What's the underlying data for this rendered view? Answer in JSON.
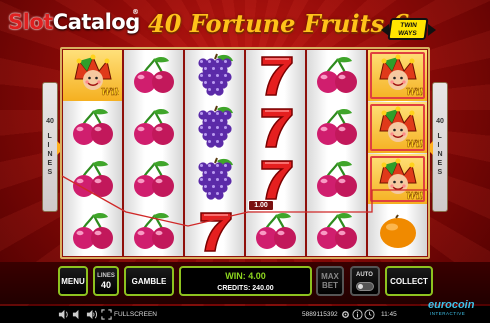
{
  "watermark": {
    "part1": "Slot",
    "part2": "Catalog",
    "mark": "®"
  },
  "title": {
    "number": "40",
    "text": "Fortune Fruits 6",
    "badge_line1": "TWIN",
    "badge_line2": "WAYS"
  },
  "side_panel": {
    "top": "40",
    "label": "LINES"
  },
  "symbol_labels": {
    "wild": "Wild"
  },
  "reels": [
    [
      "wild",
      "cherry",
      "cherry",
      "cherry"
    ],
    [
      "cherry",
      "cherry",
      "cherry",
      "cherry"
    ],
    [
      "grapes",
      "grapes",
      "grapes",
      "seven"
    ],
    [
      "seven",
      "seven",
      "seven",
      "cherry"
    ],
    [
      "cherry",
      "cherry",
      "cherry",
      "cherry"
    ],
    [
      "wild",
      "wild",
      "wild",
      "orange"
    ]
  ],
  "win_line_amount": "1.00",
  "controls": {
    "menu_label": "MENU",
    "lines_label": "LINES",
    "lines_value": "40",
    "gamble_label": "GAMBLE",
    "win_label": "WIN: 4.00",
    "credits_label": "CREDITS: 240.00",
    "max_bet_label_1": "MAX",
    "max_bet_label_2": "BET",
    "auto_label": "AUTO",
    "collect_label": "COLLECT"
  },
  "status_bar": {
    "fullscreen_label": "FULLSCREEN",
    "session_id": "5889115392",
    "time": "11:45"
  },
  "brand": {
    "name": "eurocoin",
    "sub": "INTERACTIVE"
  },
  "colors": {
    "accent_green": "#8dc21f",
    "title_gold": "#ffc21a",
    "background_red": "#8f0a08"
  }
}
